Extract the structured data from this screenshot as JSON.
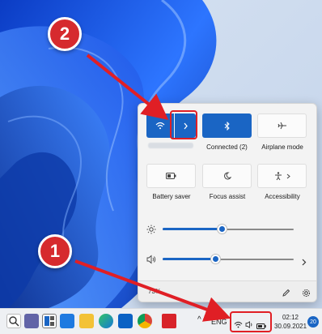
{
  "quick_settings": {
    "wifi_tile": {
      "icon": "wifi-icon",
      "expand_icon": "chevron-right-icon",
      "network_name": ""
    },
    "bluetooth_tile": {
      "icon": "bluetooth-icon",
      "label": "Connected (2)"
    },
    "airplane_tile": {
      "icon": "airplane-icon",
      "label": "Airplane mode"
    },
    "battery_saver_tile": {
      "icon": "battery-saver-icon",
      "label": "Battery saver"
    },
    "focus_assist_tile": {
      "icon": "moon-icon",
      "label": "Focus assist"
    },
    "accessibility_tile": {
      "icon": "accessibility-icon",
      "expand_icon": "chevron-right-icon",
      "label": "Accessibility"
    },
    "brightness": {
      "icon": "sun-icon",
      "level": 0.45
    },
    "volume": {
      "icon": "speaker-icon",
      "level": 0.4,
      "expand_icon": "chevron-right-icon"
    },
    "footer": {
      "battery_text": "73%",
      "edit_icon": "pencil-icon",
      "settings_icon": "gear-icon"
    }
  },
  "annotations": {
    "step1": "1",
    "step2": "2",
    "accent_color": "#d62a2e"
  },
  "taskbar": {
    "language": "ENG",
    "time": "02:12",
    "date": "30.09.2021",
    "notification_count": "20",
    "tray_up_arrow": "^",
    "apps": [
      "search-app-icon",
      "teams-icon",
      "snap-layout-icon",
      "widgets-icon",
      "explorer-icon",
      "edge-icon",
      "store-icon",
      "chrome-icon",
      "pdf-app-icon"
    ]
  },
  "colors": {
    "accent": "#1a65c4",
    "highlight": "#e01f25",
    "wallpaper_primary": "#1f5fe0"
  }
}
